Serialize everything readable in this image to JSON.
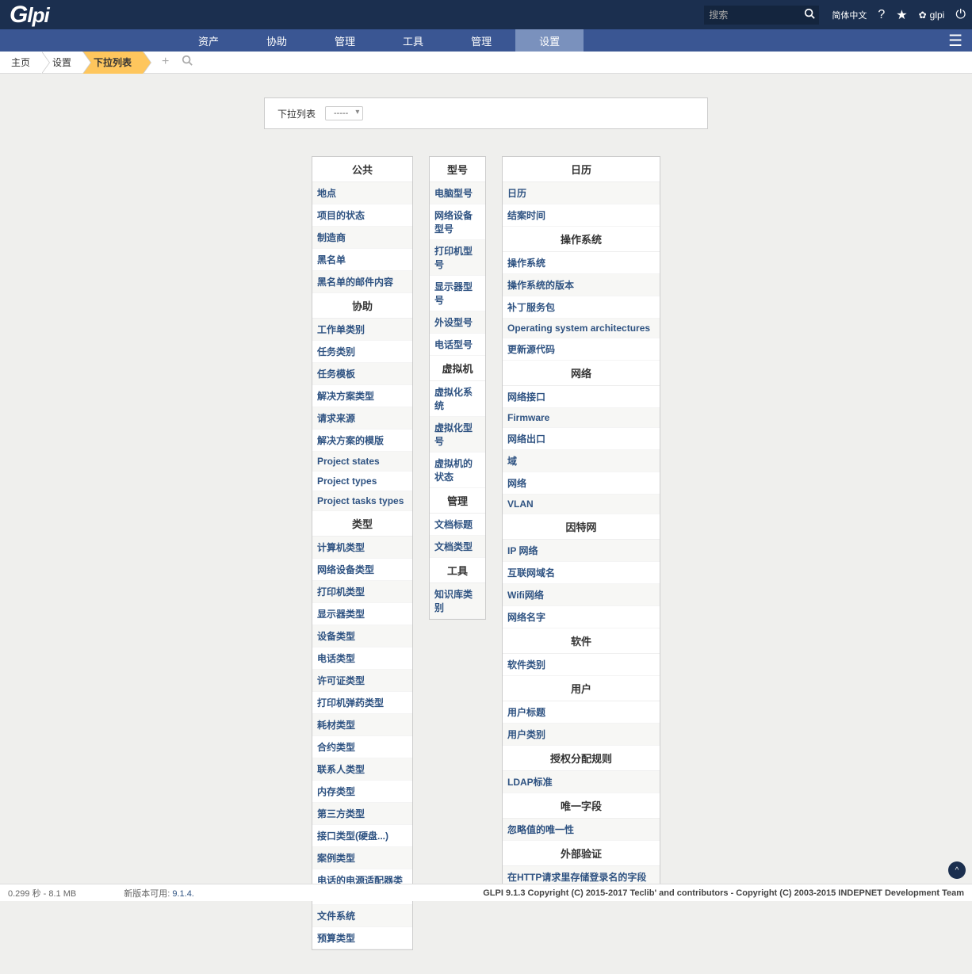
{
  "topbar": {
    "logo": "Glpi",
    "search_placeholder": "搜索",
    "lang_link": "简体中文",
    "user_label": "glpi"
  },
  "menu": {
    "items": [
      "资产",
      "协助",
      "管理",
      "工具",
      "管理",
      "设置"
    ],
    "active_index": 5
  },
  "breadcrumb": {
    "items": [
      "主页",
      "设置",
      "下拉列表"
    ],
    "active_index": 2
  },
  "dropdown_filter": {
    "label": "下拉列表",
    "value": "-----"
  },
  "col1": [
    {
      "header": "公共",
      "items": [
        "地点",
        "项目的状态",
        "制造商",
        "黑名单",
        "黑名单的邮件内容"
      ]
    },
    {
      "header": "协助",
      "items": [
        "工作单类别",
        "任务类别",
        "任务模板",
        "解决方案类型",
        "请求来源",
        "解决方案的模版",
        "Project states",
        "Project types",
        "Project tasks types"
      ]
    },
    {
      "header": "类型",
      "items": [
        "计算机类型",
        "网络设备类型",
        "打印机类型",
        "显示器类型",
        "设备类型",
        "电话类型",
        "许可证类型",
        "打印机弹药类型",
        "耗材类型",
        "合约类型",
        "联系人类型",
        "内存类型",
        "第三方类型",
        "接口类型(硬盘...)",
        "案例类型",
        "电话的电源适配器类型",
        "文件系统",
        "预算类型"
      ]
    }
  ],
  "col2": [
    {
      "header": "型号",
      "items": [
        "电脑型号",
        "网络设备型号",
        "打印机型号",
        "显示器型号",
        "外设型号",
        "电话型号"
      ]
    },
    {
      "header": "虚拟机",
      "items": [
        "虚拟化系统",
        "虚拟化型号",
        "虚拟机的状态"
      ]
    },
    {
      "header": "管理",
      "items": [
        "文档标题",
        "文档类型"
      ]
    },
    {
      "header": "工具",
      "items": [
        "知识库类别"
      ]
    }
  ],
  "col3": [
    {
      "header": "日历",
      "items": [
        "日历",
        "结案时间"
      ]
    },
    {
      "header": "操作系统",
      "items": [
        "操作系统",
        "操作系统的版本",
        "补丁服务包",
        "Operating system architectures",
        "更新源代码"
      ]
    },
    {
      "header": "网络",
      "items": [
        "网络接口",
        "Firmware",
        "网络出口",
        "域",
        "网络",
        "VLAN"
      ]
    },
    {
      "header": "因特网",
      "items": [
        "IP 网络",
        "互联网域名",
        "Wifi网络",
        "网络名字"
      ]
    },
    {
      "header": "软件",
      "items": [
        "软件类别"
      ]
    },
    {
      "header": "用户",
      "items": [
        "用户标题",
        "用户类别"
      ]
    },
    {
      "header": "授权分配规则",
      "items": [
        "LDAP标准"
      ]
    },
    {
      "header": "唯一字段",
      "items": [
        "忽略值的唯一性"
      ]
    },
    {
      "header": "外部验证",
      "items": [
        "在HTTP请求里存储登录名的字段"
      ]
    }
  ],
  "footer": {
    "timing": "0.299 秒 - 8.1 MB",
    "new_version_label": "新版本可用:",
    "new_version_link": "9.1.4.",
    "copyright": "GLPI 9.1.3 Copyright (C) 2015-2017 Teclib' and contributors - Copyright (C) 2003-2015 INDEPNET Development Team"
  }
}
